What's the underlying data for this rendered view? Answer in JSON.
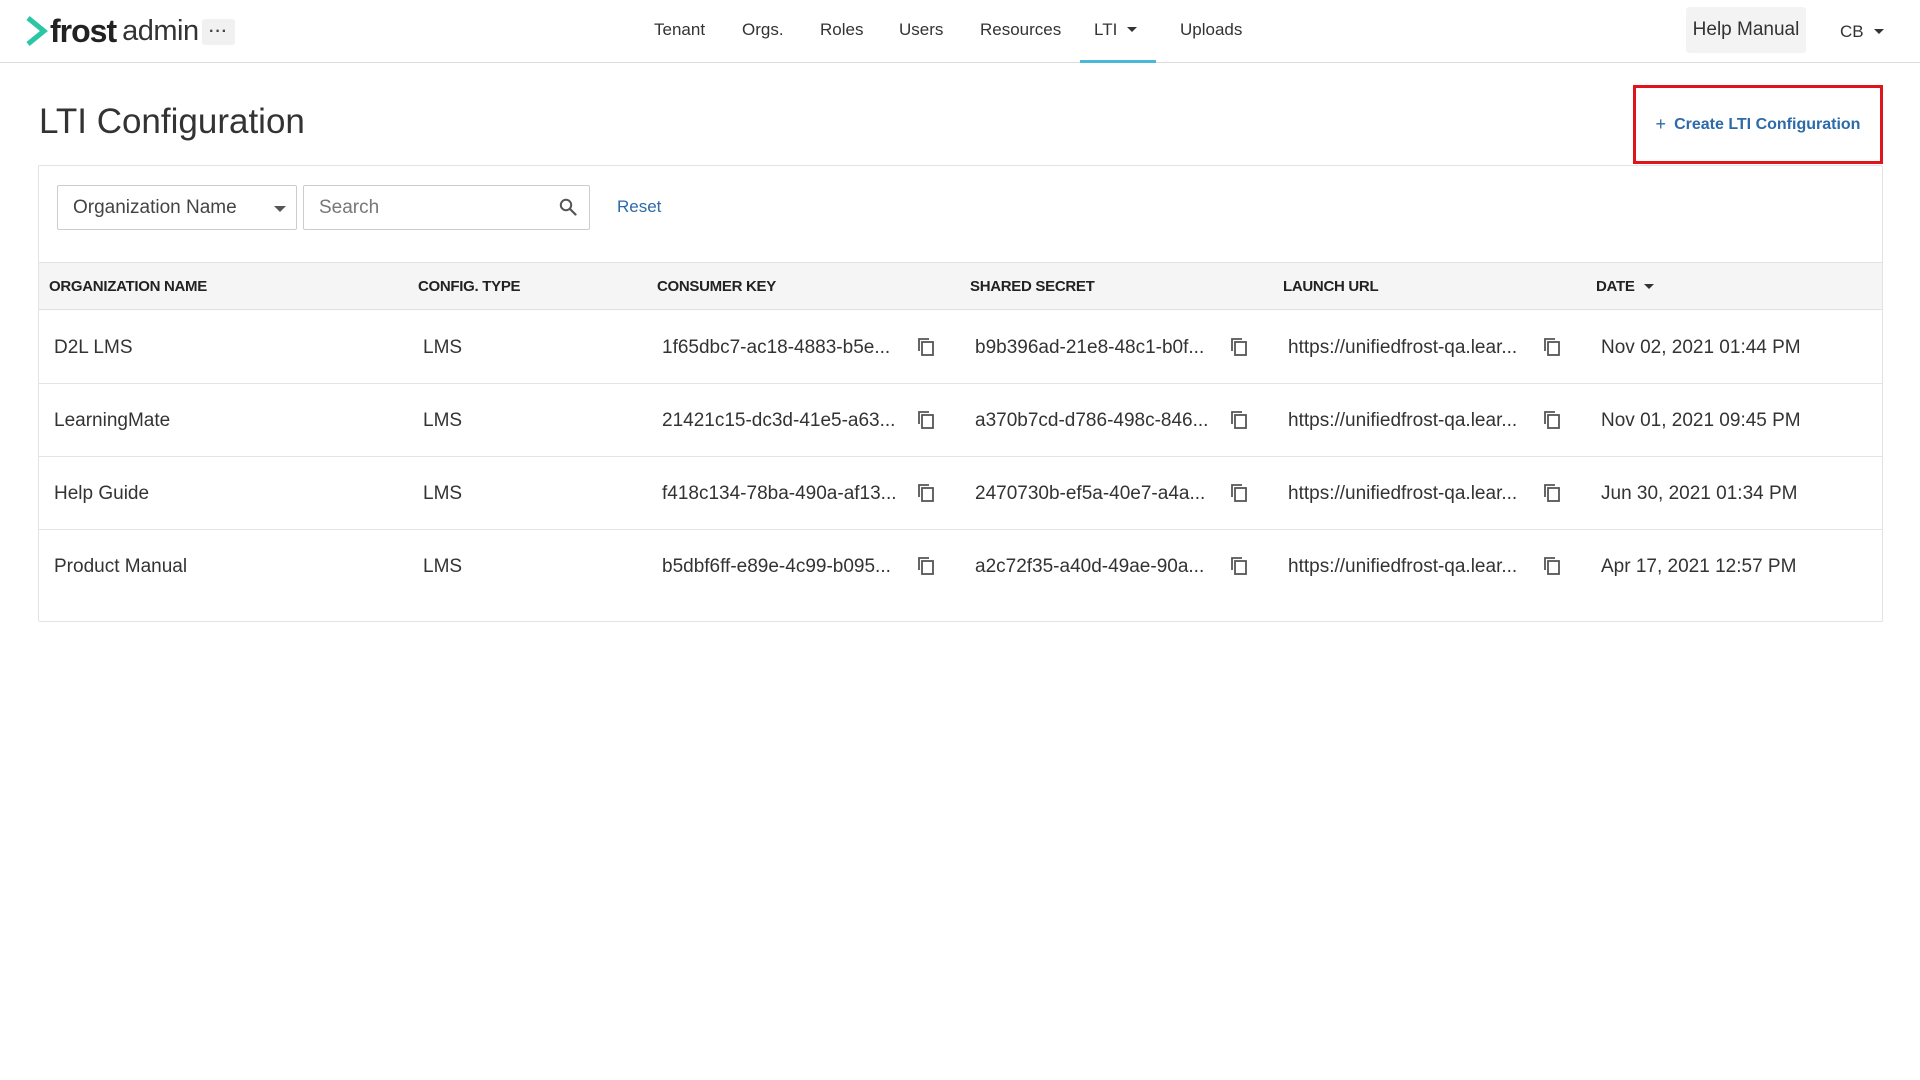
{
  "brand": {
    "name_bold": "frost",
    "name_light": "admin",
    "accent": "#2bc7a5"
  },
  "header": {
    "more_label": "···",
    "nav": [
      {
        "label": "Tenant"
      },
      {
        "label": "Orgs."
      },
      {
        "label": "Roles"
      },
      {
        "label": "Users"
      },
      {
        "label": "Resources"
      },
      {
        "label": "LTI"
      },
      {
        "label": "Uploads"
      }
    ],
    "active_nav": "LTI",
    "help_label": "Help Manual",
    "user_initials": "CB"
  },
  "page": {
    "title": "LTI Configuration",
    "create_label": "Create LTI Configuration",
    "create_plus": "+"
  },
  "filters": {
    "select_value": "Organization Name",
    "search_placeholder": "Search",
    "reset_label": "Reset"
  },
  "table": {
    "columns": [
      "ORGANIZATION NAME",
      "CONFIG. TYPE",
      "CONSUMER KEY",
      "SHARED SECRET",
      "LAUNCH URL",
      "DATE"
    ],
    "rows": [
      {
        "org": "D2L LMS",
        "type": "LMS",
        "key": "1f65dbc7-ac18-4883-b5e...",
        "secret": "b9b396ad-21e8-48c1-b0f...",
        "url": "https://unifiedfrost-qa.lear...",
        "date": "Nov 02, 2021 01:44 PM"
      },
      {
        "org": "LearningMate",
        "type": "LMS",
        "key": "21421c15-dc3d-41e5-a63...",
        "secret": "a370b7cd-d786-498c-846...",
        "url": "https://unifiedfrost-qa.lear...",
        "date": "Nov 01, 2021 09:45 PM"
      },
      {
        "org": "Help Guide",
        "type": "LMS",
        "key": "f418c134-78ba-490a-af13...",
        "secret": "2470730b-ef5a-40e7-a4a...",
        "url": "https://unifiedfrost-qa.lear...",
        "date": "Jun 30, 2021 01:34 PM"
      },
      {
        "org": "Product Manual",
        "type": "LMS",
        "key": "b5dbf6ff-e89e-4c99-b095...",
        "secret": "a2c72f35-a40d-49ae-90a...",
        "url": "https://unifiedfrost-qa.lear...",
        "date": "Apr 17, 2021 12:57 PM"
      }
    ]
  },
  "colors": {
    "link": "#2d6aa8",
    "highlight_border": "#e0141b",
    "active_underline": "#4ab8d6"
  }
}
